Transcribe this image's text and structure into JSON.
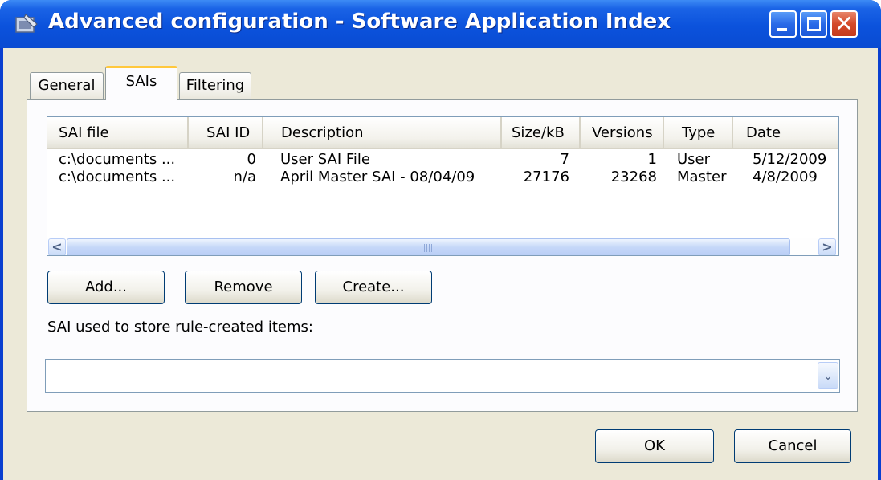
{
  "window": {
    "title": "Advanced configuration - Software Application Index",
    "icon": "app-icon",
    "controls": {
      "minimize": "minimize-icon",
      "maximize": "maximize-icon",
      "close": "close-icon",
      "close_glyph": "✕"
    }
  },
  "tabs": [
    {
      "label": "General",
      "selected": false
    },
    {
      "label": "SAIs",
      "selected": true
    },
    {
      "label": "Filtering",
      "selected": false
    }
  ],
  "sai_list": {
    "columns": [
      "SAI file",
      "SAI ID",
      "Description",
      "Size/kB",
      "Versions",
      "Type",
      "Date"
    ],
    "rows": [
      {
        "file": "c:\\documents ...",
        "id": "0",
        "description": "User SAI File",
        "size": "7",
        "versions": "1",
        "type": "User",
        "date": "5/12/2009"
      },
      {
        "file": "c:\\documents ...",
        "id": "n/a",
        "description": "April Master SAI - 08/04/09",
        "size": "27176",
        "versions": "23268",
        "type": "Master",
        "date": "4/8/2009"
      }
    ],
    "scrollbar": {
      "left_arrow": "<",
      "right_arrow": ">"
    }
  },
  "actions": {
    "add": "Add...",
    "remove": "Remove",
    "create": "Create..."
  },
  "store": {
    "label": "SAI used to store rule-created items:",
    "value": "",
    "dropdown_glyph": "⌄"
  },
  "footer": {
    "ok": "OK",
    "cancel": "Cancel"
  },
  "colors": {
    "title_bar": "#0a4bd2",
    "dialog_bg": "#ece9d8",
    "selected_tab_accent": "#ffc83c",
    "close_button": "#d44a2a"
  }
}
